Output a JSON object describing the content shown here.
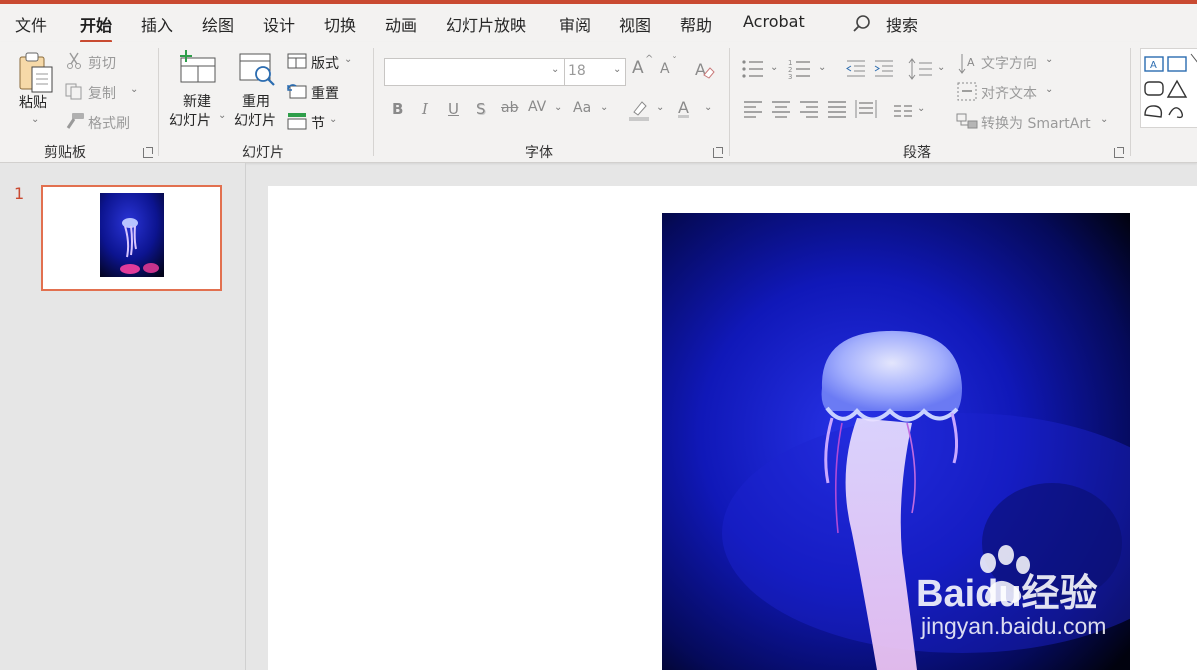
{
  "tabs": [
    "文件",
    "开始",
    "插入",
    "绘图",
    "设计",
    "切换",
    "动画",
    "幻灯片放映",
    "审阅",
    "视图",
    "帮助",
    "Acrobat"
  ],
  "active_tab": "开始",
  "search": {
    "icon": "search-icon",
    "label": "搜索"
  },
  "clipboard": {
    "paste": "粘贴",
    "cut": "剪切",
    "copy": "复制",
    "format_painter": "格式刷",
    "group_label": "剪贴板"
  },
  "slides_group": {
    "new_line1": "新建",
    "new_line2": "幻灯片",
    "reuse_line1": "重用",
    "reuse_line2": "幻灯片",
    "layout": "版式",
    "reset": "重置",
    "section": "节",
    "group_label": "幻灯片"
  },
  "font": {
    "font_name": "",
    "font_size": "18",
    "grow": "A",
    "shrink": "A",
    "bold": "B",
    "italic": "I",
    "underline": "U",
    "shadow": "S",
    "strike": "ab",
    "spacing": "AV",
    "case": "Aa",
    "color_letter": "A",
    "group_label": "字体"
  },
  "paragraph": {
    "text_direction": "文字方向",
    "align_text": "对齐文本",
    "smartart": "转换为 SmartArt",
    "group_label": "段落"
  },
  "slide_panel": {
    "number": "1"
  },
  "watermark": {
    "brand": "Baidu经验",
    "url": "jingyan.baidu.com"
  },
  "colors": {
    "accent": "#c94a31",
    "thumb_border": "#e2704f",
    "ribbon_bg": "#f3f2f1"
  }
}
